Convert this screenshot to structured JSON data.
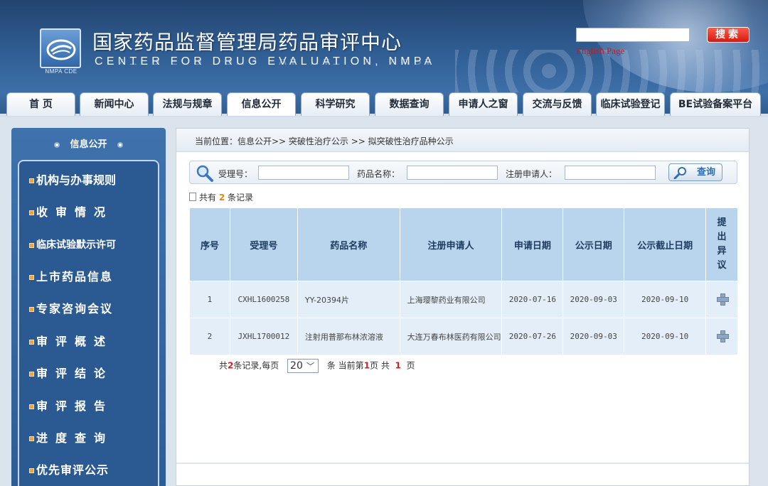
{
  "header": {
    "title": "国家药品监督管理局药品审评中心",
    "subtitle": "CENTER FOR DRUG EVALUATION, NMPA",
    "logo_caption": "NMPA CDE",
    "search_placeholder": "",
    "search_button": "搜索",
    "english_link": "English Page"
  },
  "nav": {
    "tabs": [
      {
        "label": "首 页"
      },
      {
        "label": "新闻中心"
      },
      {
        "label": "法规与规章"
      },
      {
        "label": "信息公开"
      },
      {
        "label": "科学研究"
      },
      {
        "label": "数据查询"
      },
      {
        "label": "申请人之窗"
      },
      {
        "label": "交流与反馈"
      },
      {
        "label": "临床试验登记"
      },
      {
        "label": "BE试验备案平台"
      }
    ],
    "active": "信息公开"
  },
  "sidebar": {
    "title": "信息公开",
    "items": [
      {
        "label": "机构与办事规则"
      },
      {
        "label": "收审情况"
      },
      {
        "label": "临床试验默示许可"
      },
      {
        "label": "上市药品信息"
      },
      {
        "label": "专家咨询会议"
      },
      {
        "label": "审评概述"
      },
      {
        "label": "审评结论"
      },
      {
        "label": "审评报告"
      },
      {
        "label": "进度查询"
      },
      {
        "label": "优先审评公示"
      }
    ]
  },
  "breadcrumb": {
    "text": "当前位置：信息公开>> 突破性治疗公示 >> 拟突破性治疗品种公示"
  },
  "search_form": {
    "accept_no_label": "受理号：",
    "drug_name_label": "药品名称：",
    "applicant_label": "注册申请人：",
    "query_button": "查询"
  },
  "record_count": {
    "prefix": "共有",
    "count": "2",
    "suffix": "条记录"
  },
  "table": {
    "headers": [
      "序号",
      "受理号",
      "药品名称",
      "注册申请人",
      "申请日期",
      "公示日期",
      "公示截止日期",
      "提出异议"
    ],
    "rows": [
      {
        "no": "1",
        "accept_no": "CXHL1600258",
        "drug_name": "YY-20394片",
        "applicant": "上海璎黎药业有限公司",
        "apply_date": "2020-07-16",
        "publish_date": "2020-09-03",
        "deadline": "2020-09-10"
      },
      {
        "no": "2",
        "accept_no": "JXHL1700012",
        "drug_name": "注射用普那布林浓溶液",
        "applicant": "大连万春布林医药有限公司",
        "apply_date": "2020-07-26",
        "publish_date": "2020-09-03",
        "deadline": "2020-09-10"
      }
    ]
  },
  "pagination": {
    "total_prefix": "共",
    "total": "2",
    "total_suffix": "条记录,每页",
    "page_size": "20",
    "current_prefix": "条 当前第",
    "current": "1",
    "current_suffix": "页 共",
    "pages": "1",
    "pages_suffix": "页"
  },
  "colors": {
    "header_blue": "#2f5d92",
    "search_red": "#d41a10",
    "table_header": "#b9d5ee",
    "table_row": "#e3eef8",
    "count_orange": "#e08a00",
    "page_red": "#d42020"
  }
}
